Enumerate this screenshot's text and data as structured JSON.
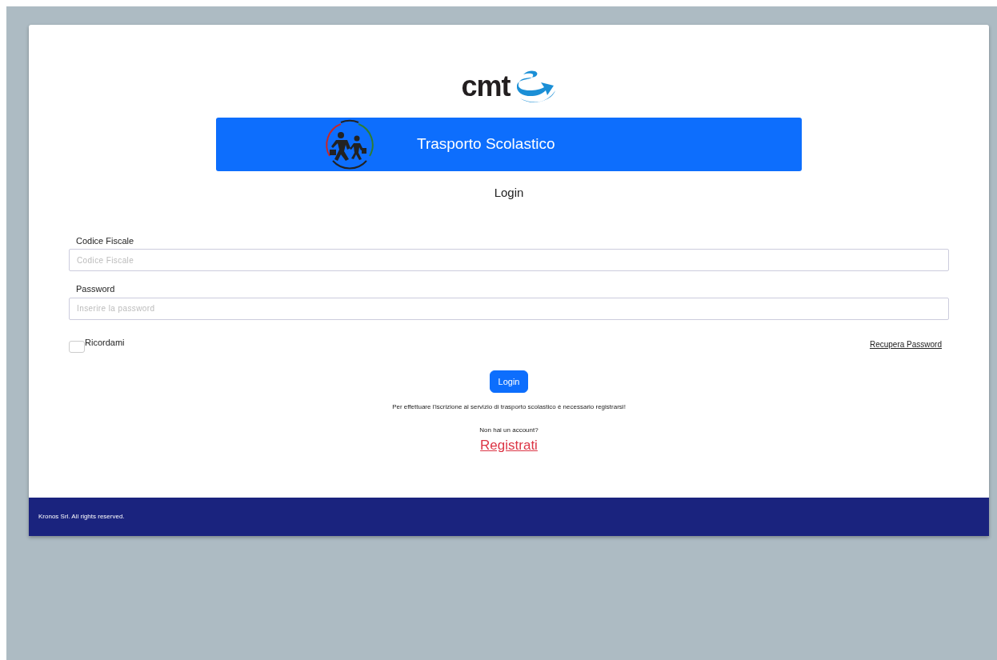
{
  "logo": {
    "text": "cmt"
  },
  "banner": {
    "title": "Trasporto Scolastico"
  },
  "heading": "Login",
  "fields": [
    {
      "label": "Codice Fiscale",
      "placeholder": "Codice Fiscale"
    },
    {
      "label": "Password",
      "placeholder": "Inserire la password"
    }
  ],
  "remember": {
    "label": "Ricordami",
    "checked": false
  },
  "recover_link": "Recupera Password",
  "login_button": "Login",
  "notice": "Per effettuare l'iscrizione al servizio di trasporto scolastico è necessario registrarsi!",
  "no_account": "Non hai un account?",
  "register_link": "Registrati",
  "footer": "Kronos Srl. All rights reserved."
}
